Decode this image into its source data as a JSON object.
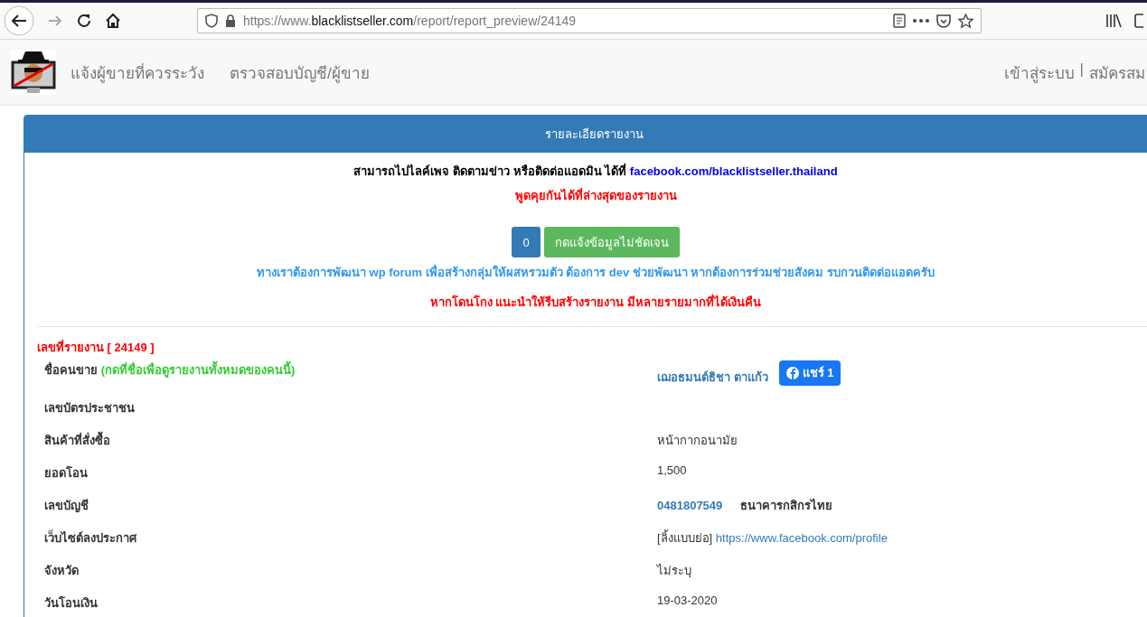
{
  "browser": {
    "url": {
      "prefix": "https://www.",
      "domain": "blacklistseller.com",
      "path": "/report/report_preview/24149"
    },
    "forward_disabled": true
  },
  "nav": {
    "links": [
      "แจ้งผู้ขายที่ควรระวัง",
      "ตรวจสอบบัญชี/ผู้ขาย"
    ],
    "login": "เข้าสู่ระบบ",
    "separator": "|",
    "register": "สมัครสม"
  },
  "panel": {
    "title": "รายละเอียดรายงาน",
    "notice": {
      "text": "สามารถไปไลค์เพจ ติดตามข่าว หรือติดต่อแอดมิน ได้ที่",
      "link": "facebook.com/blacklistseller.thailand"
    },
    "comment_hint": "พูดคุยกันได้ที่ล่างสุดของรายงาน",
    "unclear_count": "0",
    "unclear_button": "กดแจ้งข้อมูลไม่ชัดเจน",
    "dev_notice": "ทางเราต้องการพัฒนา wp forum เพื่อสร้างกลุ่มให้ผสหรวมตัว ต้องการ dev ช่วยพัฒนา หากต้องการร่วมช่วยสังคม รบกวนติดต่อแอดครับ",
    "advice": "หากโดนโกง แนะนำให้รีบสร้างรายงาน มีหลายรายมากที่ได้เงินคืน",
    "report_number": "เลขที่รายงาน [ 24149 ]",
    "rows": [
      {
        "kind": "seller",
        "label": "ชื่อคนขาย",
        "hint": "(กดที่ชื่อเพื่อดูรายงานทั้งหมดของคนนี้)",
        "value": "เฌอธมนต์ธิชา ตาแก้ว",
        "share": "แชร์ 1"
      },
      {
        "kind": "text",
        "label": "เลขบัตรประชาชน"
      },
      {
        "kind": "text",
        "label": "สินค้าที่สั่งซื้อ",
        "value": "หน้ากากอนามัย"
      },
      {
        "kind": "text",
        "label": "ยอดโอน",
        "value": "1,500"
      },
      {
        "kind": "account",
        "label": "เลขบัญชี",
        "value": "0481807549",
        "bank": "ธนาคารกสิกรไทย"
      },
      {
        "kind": "website",
        "label": "เว็บไซต์ลงประกาศ",
        "prefix": "[ลิ้งแบบย่อ]",
        "value": "https://www.facebook.com/profile"
      },
      {
        "kind": "text",
        "label": "จังหวัด",
        "value": "ไม่ระบุ"
      },
      {
        "kind": "text",
        "label": "วันโอนเงิน",
        "value": "19-03-2020"
      }
    ]
  }
}
